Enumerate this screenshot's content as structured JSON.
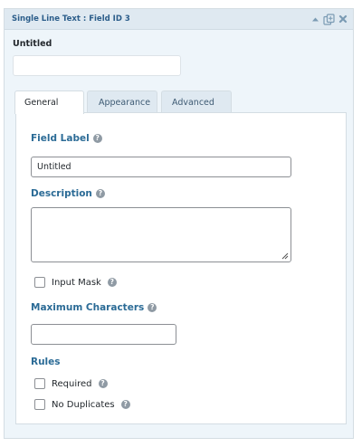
{
  "header": {
    "title": "Single Line Text : Field ID 3",
    "icons": [
      "collapse-arrow-icon",
      "duplicate-icon",
      "delete-icon"
    ]
  },
  "preview": {
    "label": "Untitled",
    "input_value": ""
  },
  "tabs": [
    {
      "label": "General",
      "active": true
    },
    {
      "label": "Appearance",
      "active": false
    },
    {
      "label": "Advanced",
      "active": false
    }
  ],
  "general": {
    "field_label": {
      "label": "Field Label",
      "value": "Untitled"
    },
    "description": {
      "label": "Description",
      "value": ""
    },
    "input_mask": {
      "label": "Input Mask",
      "checked": false
    },
    "max_chars": {
      "label": "Maximum Characters",
      "value": ""
    },
    "rules": {
      "heading": "Rules",
      "required": {
        "label": "Required",
        "checked": false
      },
      "no_duplicates": {
        "label": "No Duplicates",
        "checked": false
      }
    }
  },
  "colors": {
    "label_blue": "#2b6b96",
    "header_bg": "#dfe9f1",
    "panel_bg": "#eef5fa"
  }
}
